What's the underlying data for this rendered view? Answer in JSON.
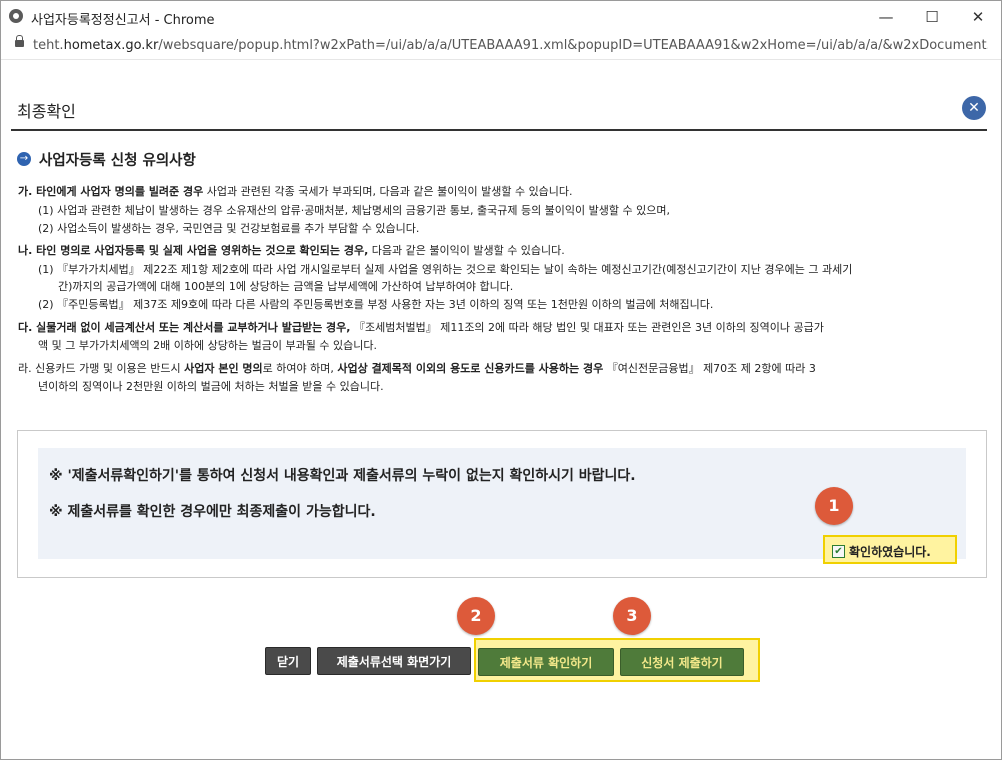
{
  "window": {
    "title": "사업자등록정정신고서 - Chrome",
    "url_prefix": "teht.",
    "url_host": "hometax.go.kr",
    "url_rest": "/websquare/popup.html?w2xPath=/ui/ab/a/a/UTEABAAA91.xml&popupID=UTEABAAA91&w2xHome=/ui/ab/a/a/&w2xDocument...",
    "minimize": "—",
    "maximize": "☐",
    "close": "✕"
  },
  "dialog": {
    "title": "최종확인",
    "close": "✕"
  },
  "section": {
    "title": "사업자등록 신청 유의사항",
    "arrow": "→"
  },
  "notices": {
    "ga": {
      "bold": "가. 타인에게 사업자 명의를 빌려준 경우",
      "text": " 사업과 관련된 각종 국세가 부과되며, 다음과 같은 불이익이 발생할 수 있습니다.",
      "items": [
        "(1) 사업과 관련한 체납이 발생하는 경우 소유재산의 압류·공매처분, 체납명세의 금융기관 통보, 출국규제 등의 불이익이 발생할 수 있으며,",
        "(2) 사업소득이 발생하는 경우, 국민연금 및 건강보험료를 추가 부담할 수 있습니다."
      ]
    },
    "na": {
      "bold": "나. 타인 명의로 사업자등록 및 실제 사업을 영위하는 것으로 확인되는 경우,",
      "text": " 다음과 같은 불이익이 발생할 수 있습니다.",
      "items": [
        "(1) 『부가가치세법』 제22조 제1항 제2호에 따라 사업 개시일로부터 실제 사업을 영위하는 것으로 확인되는 날이 속하는 예정신고기간(예정신고기간이 지난 경우에는 그 과세기",
        "간)까지의 공급가액에 대해 100분의 1에 상당하는 금액을 납부세액에 가산하여 납부하여야 합니다.",
        "(2) 『주민등록법』 제37조 제9호에 따라 다른 사람의 주민등록번호를 부정 사용한 자는 3년 이하의 징역 또는 1천만원 이하의 벌금에 처해집니다."
      ]
    },
    "da": {
      "bold": "다. 실물거래 없이 세금계산서 또는 계산서를 교부하거나 발급받는 경우,",
      "text": " 『조세범처벌법』 제11조의 2에 따라 해당 법인 및 대표자 또는 관련인은 3년 이하의 징역이나 공급가",
      "line2": "액 및 그 부가가치세액의 2배 이하에 상당하는 벌금이 부과될 수 있습니다."
    },
    "ra": {
      "p1": "라. 신용카드 가맹 및 이용은 반드시 ",
      "b1": "사업자 본인 명의",
      "p2": "로 하여야 하며, ",
      "b2": "사업상 결제목적 이외의 용도로 신용카드를 사용하는 경우",
      "p3": " 『여신전문금융법』 제70조 제 2항에 따라 3",
      "line2": "년이하의 징역이나 2천만원 이하의 벌금에 처하는 처벌을 받을 수 있습니다."
    }
  },
  "notes": [
    "※  '제출서류확인하기'를 통하여 신청서 내용확인과 제출서류의 누락이 없는지 확인하시기 바랍니다.",
    "※  제출서류를 확인한 경우에만 최종제출이 가능합니다."
  ],
  "confirm": {
    "label": "확인하였습니다.",
    "checked": true,
    "check_glyph": "✔"
  },
  "badges": [
    "1",
    "2",
    "3"
  ],
  "buttons": {
    "close": "닫기",
    "select_screen": "제출서류선택 화면가기",
    "check_docs": "제출서류 확인하기",
    "submit": "신청서 제출하기"
  },
  "colors": {
    "accent_blue": "#3d67a8",
    "badge": "#dd5a3a",
    "highlight": "#fff3a0",
    "button_green": "#4f7b3a"
  }
}
